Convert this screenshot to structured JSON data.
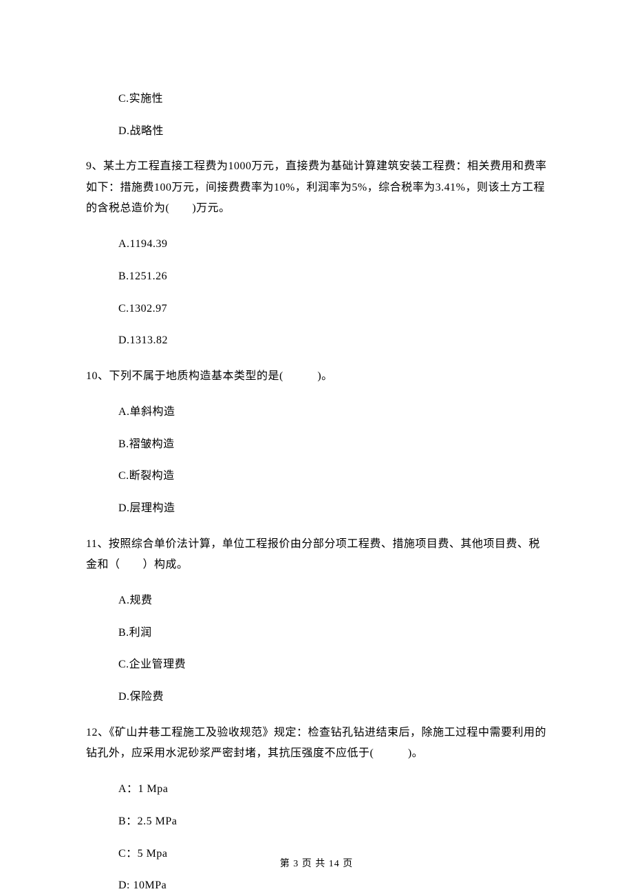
{
  "content": {
    "q8_optC": "C.实施性",
    "q8_optD": "D.战略性",
    "q9_stem": "9、某土方工程直接工程费为1000万元，直接费为基础计算建筑安装工程费：相关费用和费率如下：措施费100万元，间接费费率为10%，利润率为5%，综合税率为3.41%，则该土方工程的含税总造价为(　　)万元。",
    "q9_optA": "A.1194.39",
    "q9_optB": "B.1251.26",
    "q9_optC": "C.1302.97",
    "q9_optD": "D.1313.82",
    "q10_stem": "10、下列不属于地质构造基本类型的是(　　　)。",
    "q10_optA": "A.单斜构造",
    "q10_optB": "B.褶皱构造",
    "q10_optC": "C.断裂构造",
    "q10_optD": "D.层理构造",
    "q11_stem": "11、按照综合单价法计算，单位工程报价由分部分项工程费、措施项目费、其他项目费、税金和（　　）构成。",
    "q11_optA": "A.规费",
    "q11_optB": "B.利润",
    "q11_optC": "C.企业管理费",
    "q11_optD": "D.保险费",
    "q12_stem": "12、《矿山井巷工程施工及验收规范》规定：检查钻孔钻进结束后，除施工过程中需要利用的钻孔外，应采用水泥砂浆严密封堵，其抗压强度不应低于(　　　)。",
    "q12_optA": "A：1 Mpa",
    "q12_optB": "B：2.5 MPa",
    "q12_optC": "C：5 Mpa",
    "q12_optD": "D: 10MPa"
  },
  "footer": "第 3 页 共 14 页"
}
